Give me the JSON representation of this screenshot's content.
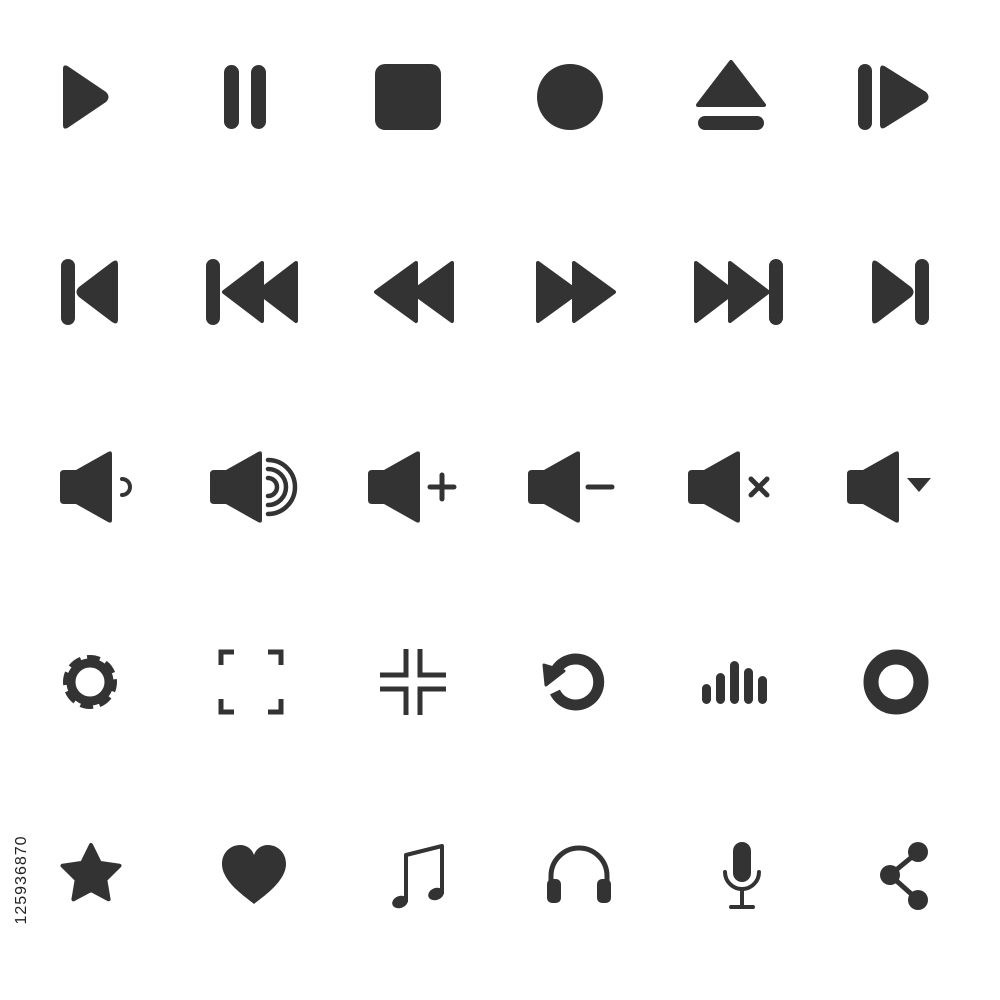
{
  "colors": {
    "icon": "#333333",
    "background": "#ffffff"
  },
  "stock_id": "125936870",
  "rows": [
    [
      "play-icon",
      "pause-icon",
      "stop-icon",
      "record-icon",
      "eject-icon",
      "play-pause-icon"
    ],
    [
      "skip-to-start-icon",
      "fast-skip-back-icon",
      "rewind-icon",
      "fast-forward-icon",
      "fast-skip-forward-icon",
      "skip-to-end-icon"
    ],
    [
      "volume-low-icon",
      "volume-high-icon",
      "volume-up-icon",
      "volume-down-icon",
      "volume-mute-icon",
      "volume-menu-icon"
    ],
    [
      "settings-gear-icon",
      "fullscreen-enter-icon",
      "fullscreen-exit-icon",
      "replay-icon",
      "equalizer-icon",
      "ring-icon"
    ],
    [
      "star-icon",
      "heart-icon",
      "music-note-icon",
      "headphones-icon",
      "microphone-icon",
      "share-icon"
    ]
  ]
}
